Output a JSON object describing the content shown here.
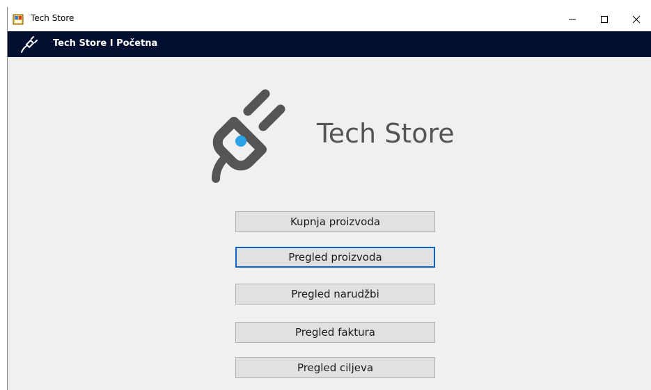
{
  "window": {
    "title": "Tech Store"
  },
  "navbar": {
    "title": "Tech Store I Početna"
  },
  "logo": {
    "text": "Tech Store"
  },
  "menu": {
    "buttons": [
      {
        "label": "Kupnja proizvoda"
      },
      {
        "label": "Pregled proizvoda"
      },
      {
        "label": "Pregled narudžbi"
      },
      {
        "label": "Pregled faktura"
      },
      {
        "label": "Pregled ciljeva"
      }
    ],
    "focused_index": 1
  },
  "colors": {
    "navbar_bg": "#020f30",
    "window_bg": "#f0f0f0",
    "logo_gray": "#555555",
    "plug_dot": "#29a3e6",
    "focus_border": "#0a64c8"
  },
  "icons": {
    "app": "app-window-icon",
    "nav": "plug-icon",
    "logo": "plug-logo-icon"
  }
}
